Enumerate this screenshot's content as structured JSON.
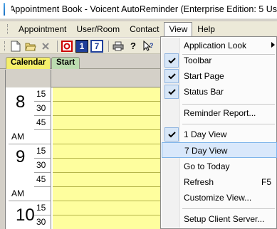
{
  "window": {
    "title": "Appointment Book - Voicent AutoReminder (Enterprise Edition: 5 Us"
  },
  "menubar": {
    "items": [
      "Appointment",
      "User/Room",
      "Contact",
      "View",
      "Help"
    ]
  },
  "toolbar": {
    "icons": [
      "new-icon",
      "open-icon",
      "delete-icon",
      "refresh-icon",
      "one-day-icon",
      "seven-day-icon",
      "print-icon",
      "help-icon",
      "whats-this-icon"
    ],
    "one_day_label": "1",
    "seven_day_label": "7"
  },
  "tabs": {
    "calendar": "Calendar",
    "start": "Start"
  },
  "calendar": {
    "rows": [
      {
        "min": "15"
      },
      {
        "min": "30"
      },
      {
        "min": "45"
      },
      {
        "ampm": "AM"
      },
      {
        "min": "15"
      },
      {
        "min": "30"
      },
      {
        "min": "45"
      },
      {
        "ampm": "AM"
      },
      {
        "min": "15"
      },
      {
        "min": "30"
      }
    ],
    "hours": [
      "8",
      "9",
      "10"
    ],
    "colors": {
      "appointment_bg": "#fefe9e",
      "calendar_tab": "#f5ef6b",
      "start_tab": "#bcdcb0"
    }
  },
  "view_menu": {
    "items": [
      {
        "label": "Application Look",
        "submenu": true
      },
      {
        "label": "Toolbar",
        "checked": true
      },
      {
        "label": "Start Page",
        "checked": true
      },
      {
        "label": "Status Bar",
        "checked": true
      },
      {
        "label": "Reminder Report..."
      },
      {
        "label": "1 Day View",
        "checked": true
      },
      {
        "label": "7 Day View",
        "highlighted": true
      },
      {
        "label": "Go to Today"
      },
      {
        "label": "Refresh",
        "shortcut": "F5"
      },
      {
        "label": "Customize View..."
      },
      {
        "label": "Setup Client Server..."
      }
    ]
  }
}
